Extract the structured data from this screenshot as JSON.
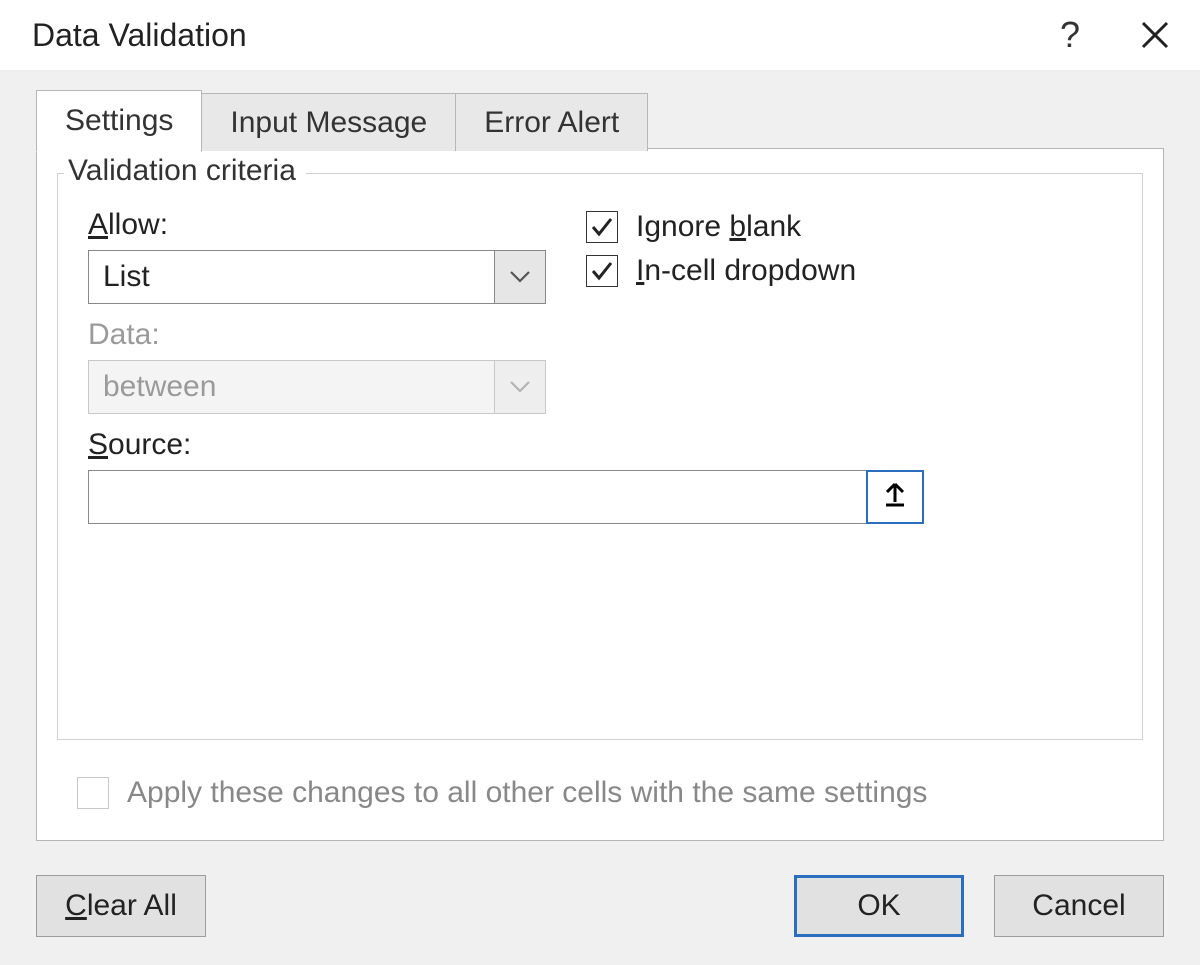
{
  "titlebar": {
    "title": "Data Validation",
    "help": "?",
    "close": "✕"
  },
  "tabs": {
    "settings": "Settings",
    "input_message": "Input Message",
    "error_alert": "Error Alert"
  },
  "fieldset": {
    "legend": "Validation criteria",
    "allow_label": "Allow:",
    "allow_value": "List",
    "data_label": "Data:",
    "data_value": "between",
    "source_label": "Source:",
    "source_value": ""
  },
  "checks": {
    "ignore_blank_pre": "Ignore ",
    "ignore_blank_ul": "b",
    "ignore_blank_post": "lank",
    "incell_pre": "",
    "incell_ul": "I",
    "incell_post": "n-cell dropdown"
  },
  "apply_all": "Apply these changes to all other cells with the same settings",
  "buttons": {
    "clear_ul": "C",
    "clear_post": "lear All",
    "ok": "OK",
    "cancel": "Cancel"
  }
}
